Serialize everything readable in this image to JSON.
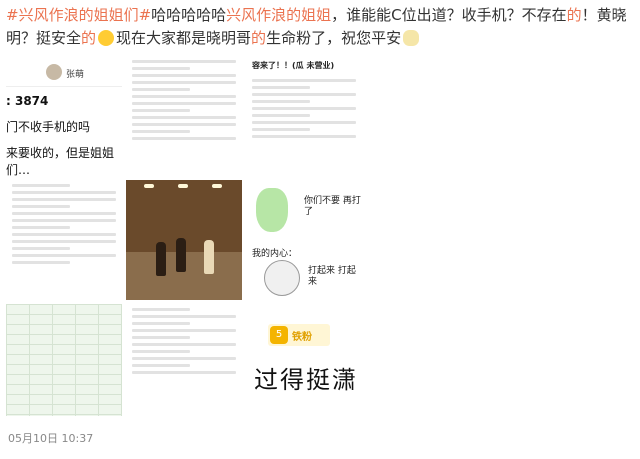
{
  "post": {
    "hashtag1": "#兴风作浪的姐姐们#",
    "text1": "哈哈哈哈哈",
    "hashtag2": "兴风作浪的姐姐",
    "text2": "，谁能能C位出道？收手机？不存在",
    "highlight1": "的",
    "text3": "！黄晓明？挺安全",
    "highlight2": "的",
    "text4": "现在大家都是晓明哥",
    "highlight3": "的",
    "text5": "生命粉了，祝您平安"
  },
  "images": {
    "img1": {
      "name": "张萌",
      "line1": ": 3874",
      "line2": "门不收手机的吗",
      "line3": "来要收的，但是姐姐们…"
    },
    "img3": {
      "head": "容来了！！(瓜 未营业)"
    },
    "img6": {
      "bubble": "你们不要 再打了",
      "mine": "我的内心：",
      "hit": "打起来 打起来"
    },
    "img9": {
      "badge_icon": "5",
      "badge": "铁粉",
      "big": "过得挺潇"
    }
  },
  "timestamp": "05月10日 10:37"
}
